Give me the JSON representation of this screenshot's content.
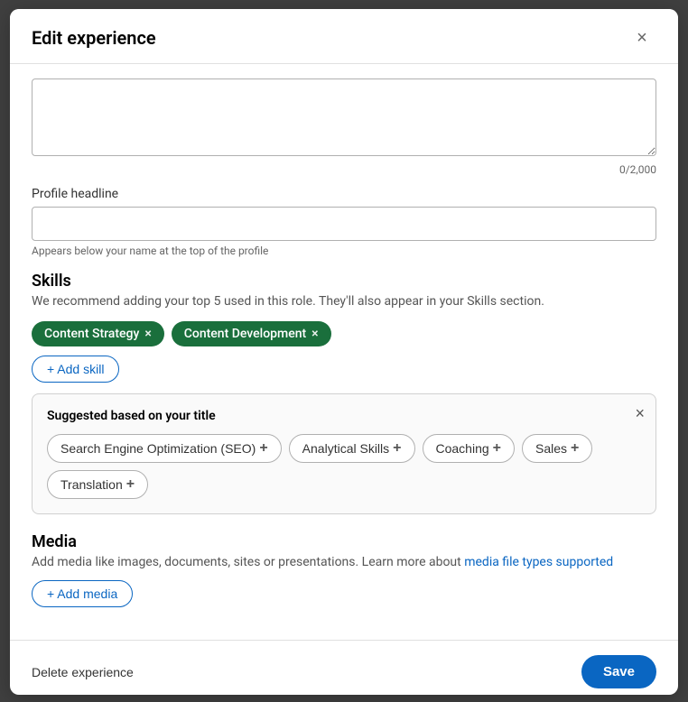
{
  "modal": {
    "title": "Edit experience",
    "close_label": "×"
  },
  "description": {
    "char_count": "0/2,000",
    "placeholder": ""
  },
  "profile_headline": {
    "label": "Profile headline",
    "hint": "Appears below your name at the top of the profile",
    "placeholder": ""
  },
  "skills": {
    "section_title": "Skills",
    "section_desc": "We recommend adding your top 5 used in this role. They'll also appear in your Skills section.",
    "tags": [
      {
        "label": "Content Strategy",
        "id": "content-strategy"
      },
      {
        "label": "Content Development",
        "id": "content-development"
      }
    ],
    "add_skill_label": "+ Add skill",
    "suggestions": {
      "title": "Suggested based on your title",
      "close_label": "×",
      "items": [
        {
          "label": "Search Engine Optimization (SEO)",
          "id": "seo"
        },
        {
          "label": "Analytical Skills",
          "id": "analytical-skills"
        },
        {
          "label": "Coaching",
          "id": "coaching"
        },
        {
          "label": "Sales",
          "id": "sales"
        },
        {
          "label": "Translation",
          "id": "translation"
        }
      ]
    }
  },
  "media": {
    "section_title": "Media",
    "desc_text": "Add media like images, documents, sites or presentations. Learn more about ",
    "link_text": "media file types supported",
    "add_media_label": "+ Add media"
  },
  "footer": {
    "delete_label": "Delete experience",
    "save_label": "Save"
  },
  "colors": {
    "accent": "#0a66c2",
    "skill_tag_bg": "#1a6f3c",
    "save_btn_bg": "#0a66c2"
  }
}
